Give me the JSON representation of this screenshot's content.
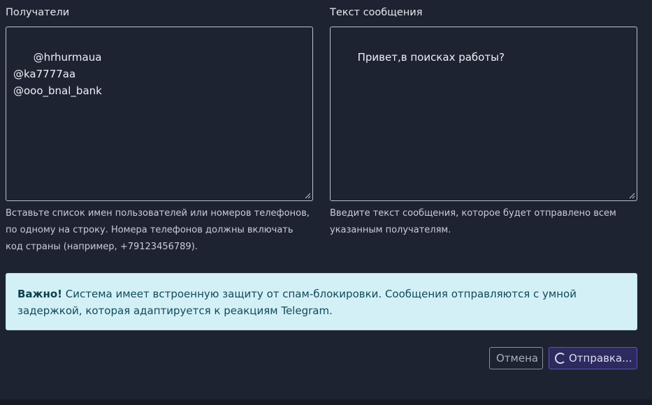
{
  "recipients": {
    "label": "Получатели",
    "value": "@hrhurmaua\n@ka7777aa\n@ooo_bnal_bank",
    "help": "Вставьте список имен пользователей или номеров телефонов, по одному на строку. Номера телефонов должны включать код страны (например, +79123456789)."
  },
  "message": {
    "label": "Текст сообщения",
    "value": "Привет,в поисках работы?",
    "help": "Введите текст сообщения, которое будет отправлено всем указанным получателям."
  },
  "alert": {
    "strong": "Важно!",
    "text": " Система имеет встроенную защиту от спам-блокировки. Сообщения отправляются с умной задержкой, которая адаптируется к реакциям Telegram."
  },
  "buttons": {
    "cancel": "Отмена",
    "send": "Отправка..."
  },
  "icons": {
    "spinner": "spinner-icon",
    "resize": "resize-grip-icon"
  },
  "colors": {
    "background": "#1e2332",
    "alert_background": "#d4f0f7",
    "alert_text": "#0f4a5a",
    "send_button": "#2c2a5e",
    "send_border": "#5b55b8"
  }
}
